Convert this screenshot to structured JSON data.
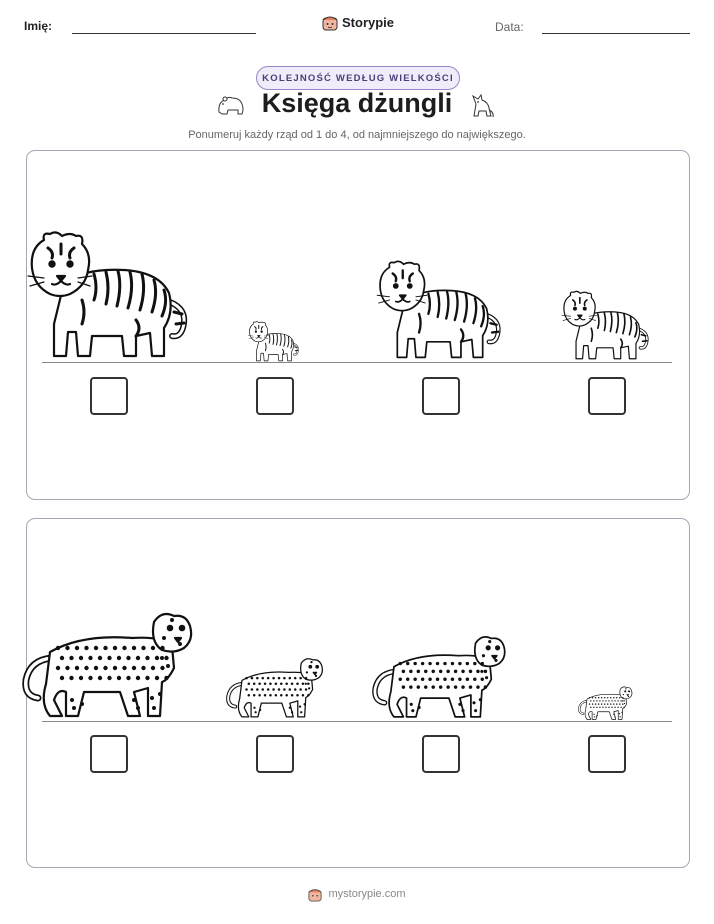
{
  "header": {
    "name_label": "Imię:",
    "date_label": "Data:",
    "brand": "Storypie",
    "brand_icon": "pie-mascot-icon"
  },
  "badge": "KOLEJNOŚĆ WEDŁUG WIELKOŚCI",
  "title": "Księga dżungli",
  "title_icons": [
    "bear-icon",
    "wolf-icon"
  ],
  "subtitle": "Ponumeruj każdy rząd od 1 do 4, od najmniejszego do największego.",
  "rows": [
    {
      "animal": "tiger",
      "sizes": [
        1.0,
        0.32,
        0.78,
        0.55
      ],
      "answers": [
        "",
        "",
        "",
        ""
      ]
    },
    {
      "animal": "leopard",
      "sizes": [
        1.0,
        0.58,
        0.78,
        0.32
      ],
      "answers": [
        "",
        "",
        "",
        ""
      ]
    }
  ],
  "footer": {
    "text": "mystorypie.com",
    "icon": "pie-mascot-icon"
  },
  "colors": {
    "badge_border": "#9a86c8",
    "badge_bg": "#f1ecfa",
    "badge_text": "#4b3f78",
    "panel_border": "#a7a7b3"
  }
}
